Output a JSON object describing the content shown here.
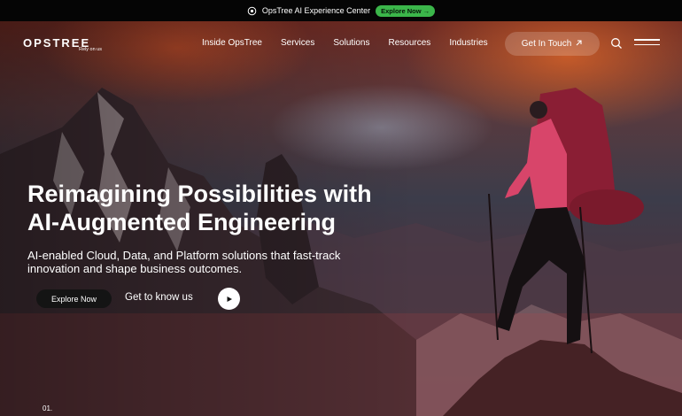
{
  "announcement": {
    "text": "OpsTree AI Experience Center",
    "cta": "Explore Now →",
    "cta_color": "#3bb64a"
  },
  "nav": {
    "logo_text": "OPSTREE",
    "logo_tagline": "Rely on us",
    "items": [
      "Inside OpsTree",
      "Services",
      "Solutions",
      "Resources",
      "Industries"
    ],
    "cta_label": "Get In Touch",
    "cta_icon": "arrow-up-right-icon",
    "search_icon": "search-icon",
    "menu_icon": "hamburger-menu-icon"
  },
  "hero": {
    "headline_line1": "Reimagining Possibilities with",
    "headline_line2": "AI-Augmented Engineering",
    "subtitle_line1": "AI-enabled Cloud, Data, and Platform solutions that fast-track",
    "subtitle_line2": "innovation and shape business outcomes.",
    "primary_button": "Explore Now",
    "secondary_link": "Get to know us",
    "play_icon": "play-icon",
    "slide_number": "01."
  }
}
